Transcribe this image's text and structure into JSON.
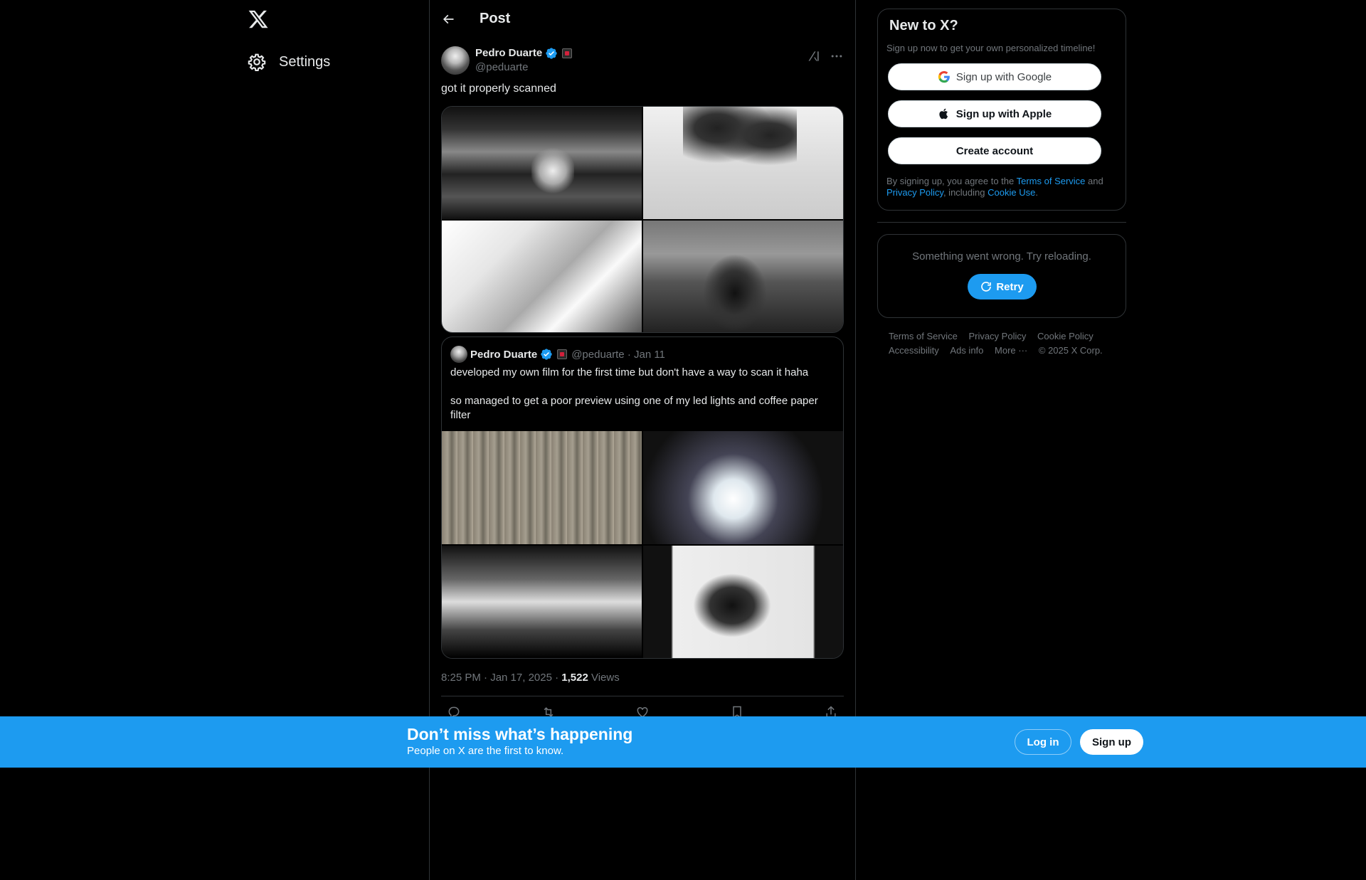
{
  "nav": {
    "settings_label": "Settings"
  },
  "header": {
    "title": "Post"
  },
  "tweet": {
    "author_name": "Pedro Duarte",
    "author_handle": "@peduarte",
    "text": "got it properly scanned",
    "timestamp": "8:25 PM · Jan 17, 2025 · ",
    "views_count": "1,522",
    "views_label": " Views"
  },
  "quote": {
    "author_name": "Pedro Duarte",
    "meta": "@peduarte · Jan 11",
    "text_1": "developed my own film for the first time but don't have a way to scan it haha",
    "text_2": "so managed to get a poor preview using one of my led lights and coffee paper filter"
  },
  "signup_card": {
    "title": "New to X?",
    "subtitle": "Sign up now to get your own personalized timeline!",
    "google_label": "Sign up with Google",
    "apple_label": "Sign up with Apple",
    "create_label": "Create account",
    "legal_1": "By signing up, you agree to the ",
    "terms_link": "Terms of Service",
    "legal_2": " and ",
    "privacy_link": "Privacy Policy",
    "legal_3": ", including ",
    "cookie_link": "Cookie Use",
    "legal_4": "."
  },
  "error_card": {
    "message": "Something went wrong. Try reloading.",
    "retry_label": "Retry"
  },
  "footer": {
    "links": [
      "Terms of Service",
      "Privacy Policy",
      "Cookie Policy",
      "Accessibility",
      "Ads info",
      "More ···",
      "© 2025 X Corp."
    ]
  },
  "banner": {
    "title": "Don’t miss what’s happening",
    "subtitle": "People on X are the first to know.",
    "login_label": "Log in",
    "signup_label": "Sign up"
  },
  "colors": {
    "accent": "#1d9bf0",
    "background": "#000000",
    "border": "#2f3336",
    "muted_text": "#71767b"
  }
}
